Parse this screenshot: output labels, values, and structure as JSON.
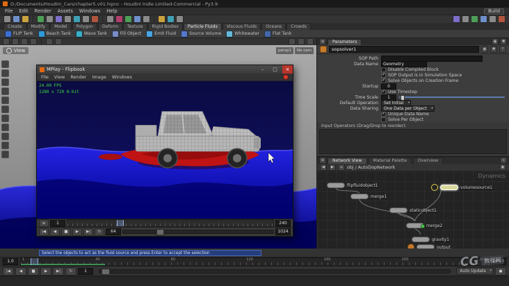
{
  "window": {
    "title": "D:/Documents/Houdini_Cars/chapter5.v01.hipnc - Houdini Indie Limited-Commercial - Py3.9",
    "right_label": "Build"
  },
  "menus": [
    "File",
    "Edit",
    "Render",
    "Assets",
    "Windows",
    "Help"
  ],
  "shelf": {
    "tabs": [
      "Create",
      "Modify",
      "Model",
      "Polygon",
      "Deform",
      "Texture",
      "Rigid Bodies",
      "Particle Fluids",
      "Viscous Fluids",
      "Oceans",
      "Crowds"
    ],
    "tools": [
      "FLIP Tank",
      "Beach Tank",
      "Wave Tank",
      "Fill Object",
      "Emit Fluid",
      "Source Volume",
      "Whitewater",
      "Flat Tank"
    ]
  },
  "viewport": {
    "label": "View",
    "persp": "persp1",
    "cam": "No cam"
  },
  "status": {
    "hint": "Select the objects to act as the fluid source and press Enter to accept the selection"
  },
  "mplay": {
    "title": "MPlay - Flipbook",
    "menus": [
      "File",
      "View",
      "Render",
      "Image",
      "Windows"
    ],
    "overlay_line1": "24.00 FPS",
    "overlay_line2": "1280 x 720  8-bit",
    "start": "1",
    "end": "240",
    "current": "64",
    "res": "1024"
  },
  "params": {
    "tab": "Parameters",
    "node_name": "sopsolver1",
    "rows": [
      {
        "label": "SOP Path",
        "value": ""
      },
      {
        "label": "Data Name",
        "value": "Geometry"
      },
      {
        "check": "",
        "text": "Disable Compiled Block"
      },
      {
        "check": "✓",
        "text": "SOP Output is in Simulation Space"
      },
      {
        "check": "✓",
        "text": "Solve Objects on Creation Frame"
      },
      {
        "label": "Startup",
        "value": "0"
      },
      {
        "check": "✓",
        "text": "Use Timestep"
      },
      {
        "label": "Time Scale",
        "value": "1"
      },
      {
        "label": "Default Operation",
        "value": "Set Initial"
      },
      {
        "label": "Data Sharing",
        "value": "One Data per Object"
      },
      {
        "check": "✓",
        "text": "Unique Data Name"
      },
      {
        "check": "",
        "text": "Solve Per Object"
      },
      {
        "footer_label": "Input Operators (Drag/Drop to reorder):"
      }
    ]
  },
  "network": {
    "tabs": [
      "Network View",
      "Material Palette",
      "Overview"
    ],
    "path": "obj / AutoDopNetwork",
    "badge": "Dynamics",
    "nodes": [
      {
        "label": "flipfluidobject1"
      },
      {
        "label": "merge1"
      },
      {
        "label": "volumesource1"
      },
      {
        "label": "staticobject1"
      },
      {
        "label": "merge2"
      },
      {
        "label": "gravity1"
      },
      {
        "label": "output"
      }
    ]
  },
  "playbar": {
    "start": "1.0",
    "end": "240.0",
    "current": "1",
    "ticks": [
      "1",
      "40",
      "80",
      "120",
      "160",
      "200",
      "240"
    ],
    "auto_update": "Auto Update"
  },
  "watermark": {
    "big": "CG",
    "box": "教程网"
  },
  "icons": {
    "to_start": "|◀",
    "step_back": "◀",
    "stop": "■",
    "play": "▶",
    "to_end": "▶|",
    "rec": "●",
    "close": "×",
    "min": "–",
    "max": "□",
    "menu": "≡",
    "home": "⌂",
    "back": "◀",
    "fwd": "▶",
    "pin": "◉",
    "gear": "✱",
    "help": "?",
    "loop": "↻",
    "plus": "+"
  }
}
